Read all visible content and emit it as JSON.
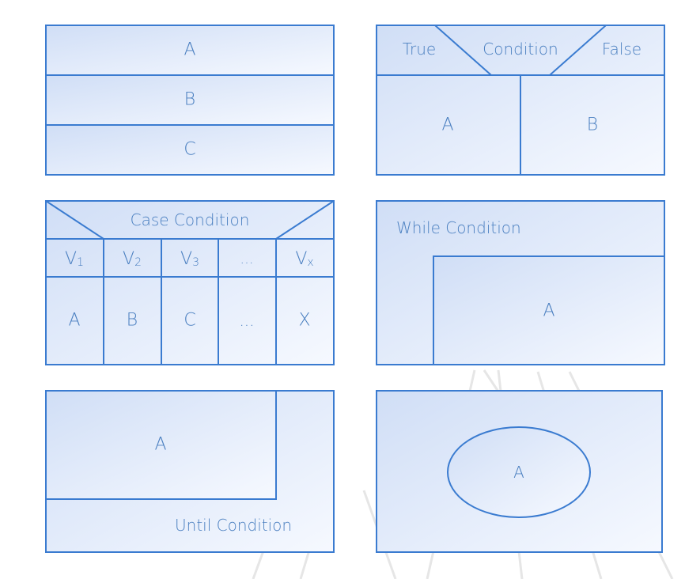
{
  "sequence": {
    "a": "A",
    "b": "B",
    "c": "C"
  },
  "if_else": {
    "true_label": "True",
    "condition": "Condition",
    "false_label": "False",
    "a": "A",
    "b": "B"
  },
  "case": {
    "condition": "Case Condition",
    "values": [
      {
        "main": "V",
        "sub": "1"
      },
      {
        "main": "V",
        "sub": "2"
      },
      {
        "main": "V",
        "sub": "3"
      },
      {
        "main": "...",
        "sub": ""
      },
      {
        "main": "V",
        "sub": "x"
      }
    ],
    "actions": [
      "A",
      "B",
      "C",
      "...",
      "X"
    ]
  },
  "while_loop": {
    "condition": "While Condition",
    "a": "A"
  },
  "until_loop": {
    "condition": "Until Condition",
    "a": "A"
  },
  "subroutine": {
    "a": "A"
  },
  "colors": {
    "stroke": "#3a7bd0",
    "fill_light": "#f4f8ff",
    "fill_dark": "#d2e0f7",
    "text": "#4a7fc0"
  }
}
